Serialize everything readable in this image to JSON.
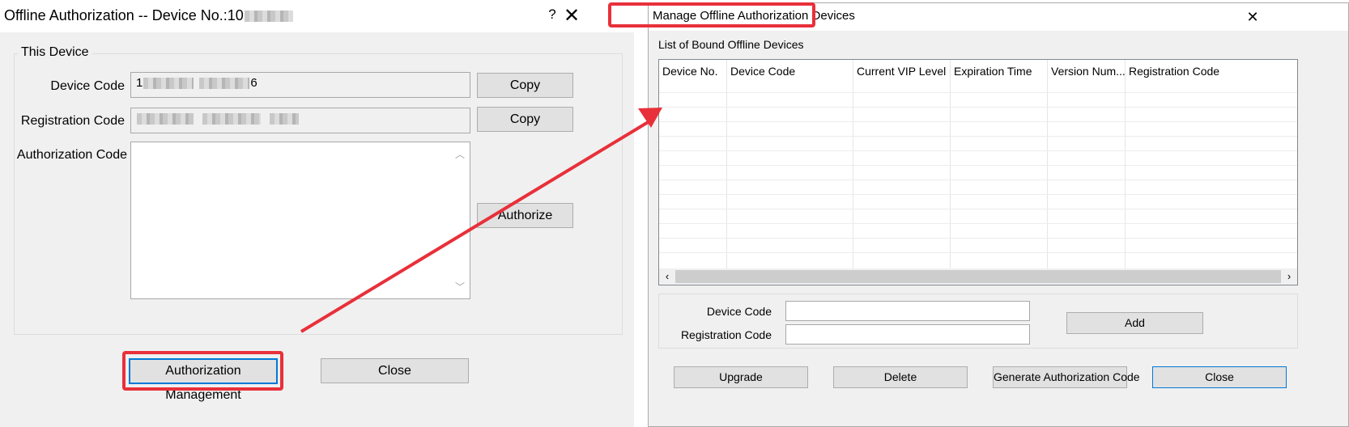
{
  "left_dialog": {
    "title": "Offline Authorization -- Device No.:10",
    "help_label": "?",
    "group_label": "This Device",
    "device_code_label": "Device Code",
    "device_code_value_start": "1",
    "device_code_value_end": "6",
    "registration_code_label": "Registration Code",
    "authorization_code_label": "Authorization Code",
    "copy_label": "Copy",
    "authorize_label": "Authorize",
    "auth_management_label": "Authorization Management",
    "close_label": "Close"
  },
  "right_dialog": {
    "title": "Manage Offline Authorization Devices",
    "list_label": "List of Bound Offline Devices",
    "columns": [
      "Device No.",
      "Device Code",
      "Current VIP Level",
      "Expiration Time",
      "Version Num...",
      "Registration Code"
    ],
    "device_code_label": "Device Code",
    "registration_code_label": "Registration Code",
    "add_label": "Add",
    "upgrade_label": "Upgrade",
    "delete_label": "Delete",
    "generate_label": "Generate Authorization Code",
    "close_label": "Close"
  },
  "icons": {
    "close": "close-icon",
    "help": "help-icon",
    "arrow": "red-arrow-annotation"
  },
  "colors": {
    "annotation_red": "#e8303a",
    "focus_blue": "#0078d7",
    "dialog_bg": "#f0f0f0"
  }
}
